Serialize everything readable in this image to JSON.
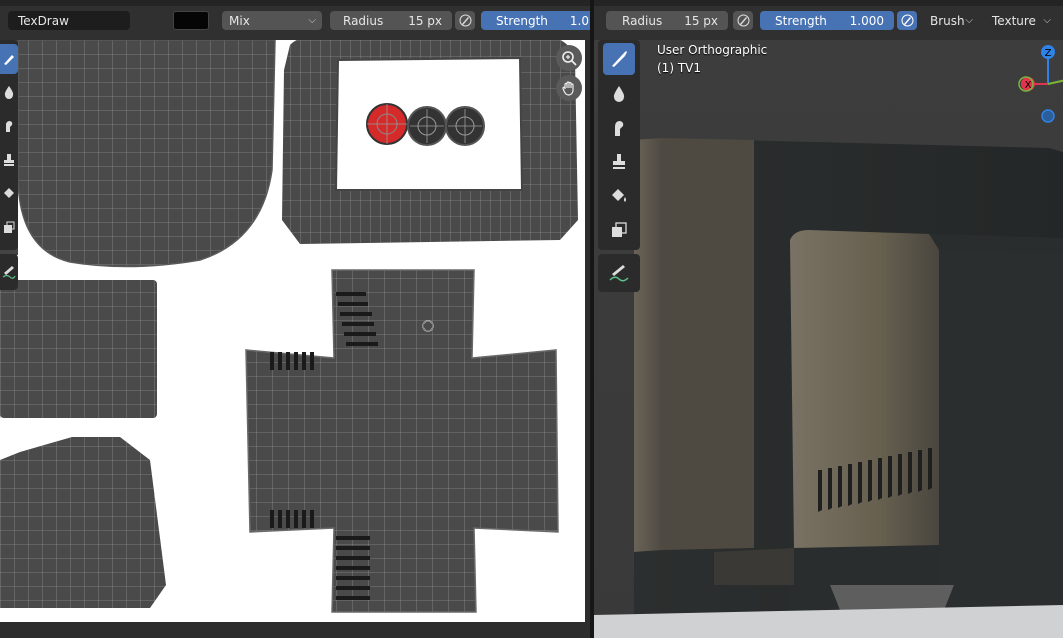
{
  "left_header": {
    "brush_name": "TexDraw",
    "color_swatch": "#050505",
    "blend_mode": "Mix",
    "radius_label": "Radius",
    "radius_value": "15 px",
    "strength_label": "Strength",
    "strength_value": "1.0"
  },
  "right_header": {
    "radius_label": "Radius",
    "radius_value": "15 px",
    "strength_label": "Strength",
    "strength_value": "1.000",
    "brush_menu": "Brush",
    "texture_menu": "Texture"
  },
  "viewport": {
    "view_name": "User Orthographic",
    "object_name": "(1) TV1",
    "gizmo": {
      "z_label": "Z",
      "x_label": "X"
    }
  },
  "left_tools": [
    "draw-tool",
    "soften-tool",
    "smear-tool",
    "clone-tool",
    "fill-tool",
    "mask-tool",
    "annotate-tool"
  ],
  "right_tools": [
    "draw-tool",
    "soften-tool",
    "smear-tool",
    "clone-tool",
    "fill-tool",
    "mask-tool",
    "annotate-tool"
  ],
  "colors": {
    "accent": "#4772b3",
    "header_bg": "#303030",
    "uv_face_fill": "#4a4a4a",
    "uv_wire": "#8a8a8a",
    "selected_red": "#d42a2a",
    "gizmo_red": "#e3334e",
    "gizmo_blue": "#2f83e8"
  }
}
